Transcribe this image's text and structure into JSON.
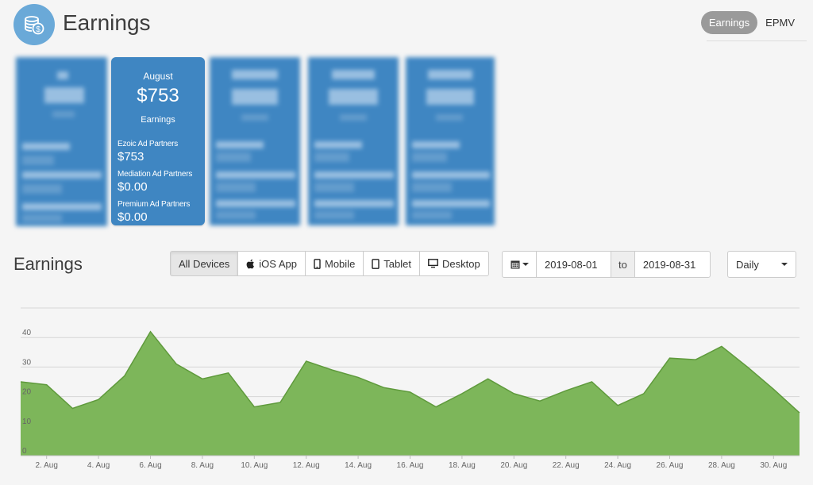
{
  "header": {
    "title": "Earnings",
    "icon": "coins-icon"
  },
  "view_toggle": {
    "earnings": "Earnings",
    "epmv": "EPMV",
    "active": "Earnings"
  },
  "summary_card": {
    "month": "August",
    "amount": "$753",
    "caption": "Earnings",
    "partners": [
      {
        "label": "Ezoic Ad Partners",
        "value": "$753"
      },
      {
        "label": "Mediation Ad Partners",
        "value": "$0.00"
      },
      {
        "label": "Premium Ad Partners",
        "value": "$0.00"
      }
    ]
  },
  "section_title": "Earnings",
  "device_filter": {
    "active": "All Devices",
    "options": [
      {
        "label": "All Devices",
        "icon": ""
      },
      {
        "label": "iOS App",
        "icon": "apple-icon"
      },
      {
        "label": "Mobile",
        "icon": "mobile-icon"
      },
      {
        "label": "Tablet",
        "icon": "tablet-icon"
      },
      {
        "label": "Desktop",
        "icon": "desktop-icon"
      }
    ]
  },
  "date_range": {
    "start": "2019-08-01",
    "separator": "to",
    "end": "2019-08-31"
  },
  "period": {
    "selected": "Daily"
  },
  "colors": {
    "card": "#3f86c2",
    "area_fill": "#7db65a",
    "area_line": "#5f9a3c",
    "header_icon": "#6aa9d8"
  },
  "chart_data": {
    "type": "area",
    "x": [
      "1. Aug",
      "2. Aug",
      "3. Aug",
      "4. Aug",
      "5. Aug",
      "6. Aug",
      "7. Aug",
      "8. Aug",
      "9. Aug",
      "10. Aug",
      "11. Aug",
      "12. Aug",
      "13. Aug",
      "14. Aug",
      "15. Aug",
      "16. Aug",
      "17. Aug",
      "18. Aug",
      "19. Aug",
      "20. Aug",
      "21. Aug",
      "22. Aug",
      "23. Aug",
      "24. Aug",
      "25. Aug",
      "26. Aug",
      "27. Aug",
      "28. Aug",
      "29. Aug",
      "30. Aug",
      "31. Aug"
    ],
    "x_tick_labels": [
      "2. Aug",
      "4. Aug",
      "6. Aug",
      "8. Aug",
      "10. Aug",
      "12. Aug",
      "14. Aug",
      "16. Aug",
      "18. Aug",
      "20. Aug",
      "22. Aug",
      "24. Aug",
      "26. Aug",
      "28. Aug",
      "30. Aug"
    ],
    "values": [
      25,
      24,
      16,
      19,
      27,
      42,
      31,
      26,
      28,
      16.5,
      18,
      32,
      29,
      26.5,
      23,
      21.5,
      16.5,
      21,
      26,
      21,
      18.5,
      22,
      25,
      17,
      21,
      33,
      32.5,
      37,
      30,
      22.5,
      14.5
    ],
    "yticks": [
      0,
      10,
      20,
      30,
      40
    ],
    "ylim": [
      0,
      50
    ],
    "grid": true
  }
}
